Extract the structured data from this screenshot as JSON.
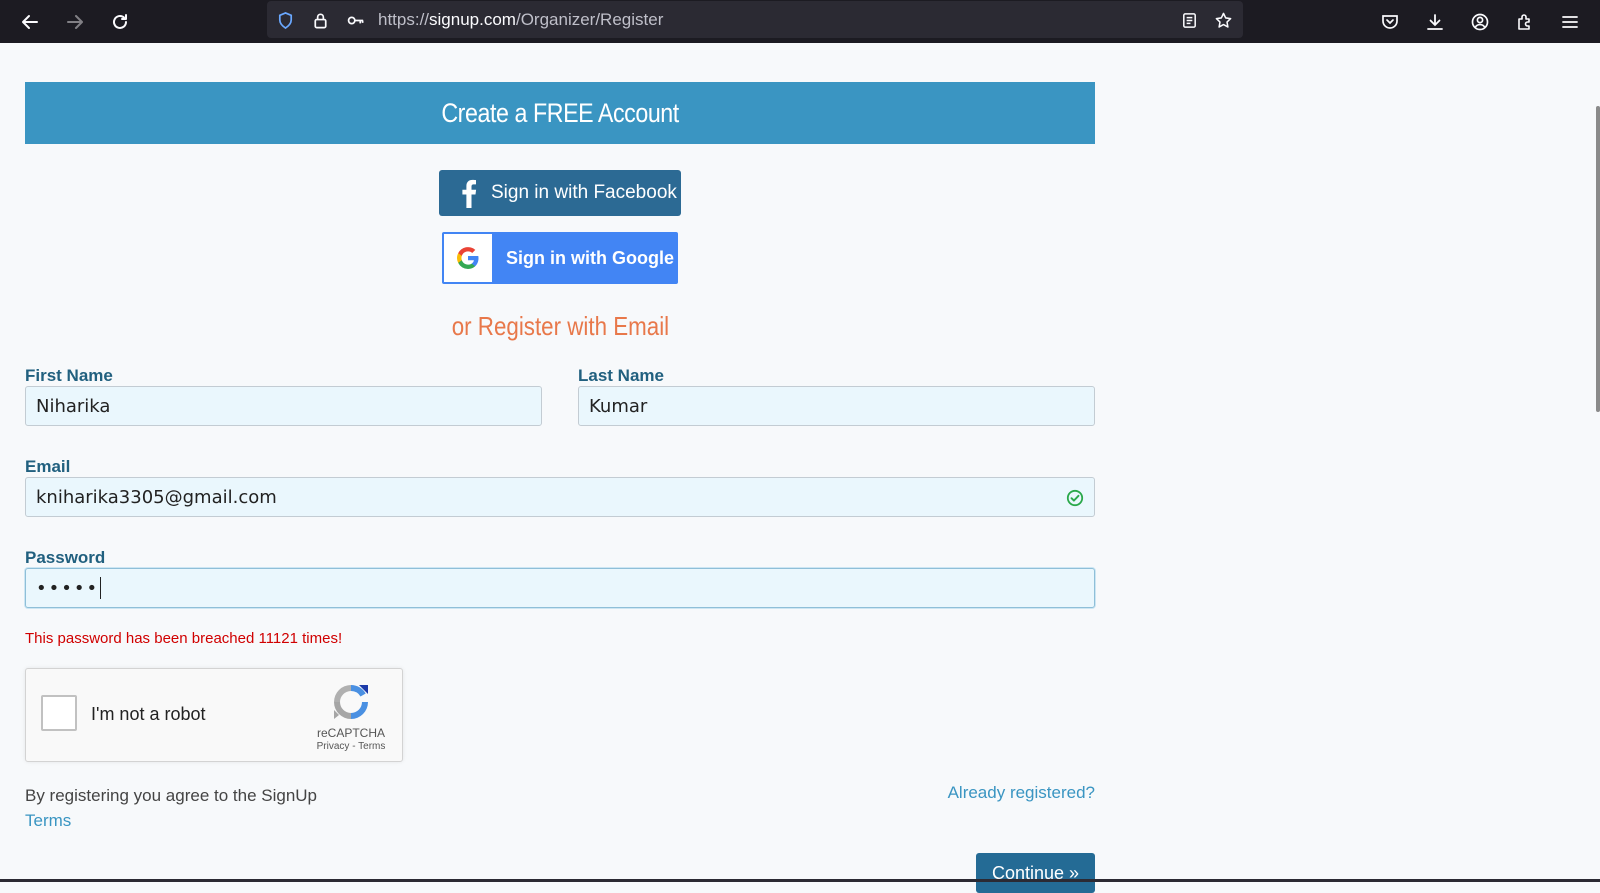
{
  "browser": {
    "url_prefix": "https://",
    "url_host": "signup.com",
    "url_path": "/Organizer/Register"
  },
  "header": {
    "title": "Create a FREE Account"
  },
  "social": {
    "facebook_label": "Sign in with Facebook",
    "google_label": "Sign in with Google"
  },
  "form": {
    "or_title": "or Register with Email",
    "first_name_label": "First Name",
    "first_name_value": "Niharika",
    "last_name_label": "Last Name",
    "last_name_value": "Kumar",
    "email_label": "Email",
    "email_value": "kniharika3305@gmail.com",
    "password_label": "Password",
    "password_masked": "•••••",
    "password_error": "This password has been breached 11121 times!"
  },
  "captcha": {
    "label": "I'm not a robot",
    "brand": "reCAPTCHA",
    "links": "Privacy - Terms"
  },
  "footer": {
    "agree_text": "By registering you agree to the SignUp",
    "terms_link": "Terms",
    "already_registered": "Already registered?",
    "continue_label": "Continue »"
  },
  "colors": {
    "header_band": "#3a95c2",
    "facebook": "#2c6a94",
    "google": "#4285f4",
    "accent_orange": "#e8784a",
    "error": "#d00000"
  }
}
